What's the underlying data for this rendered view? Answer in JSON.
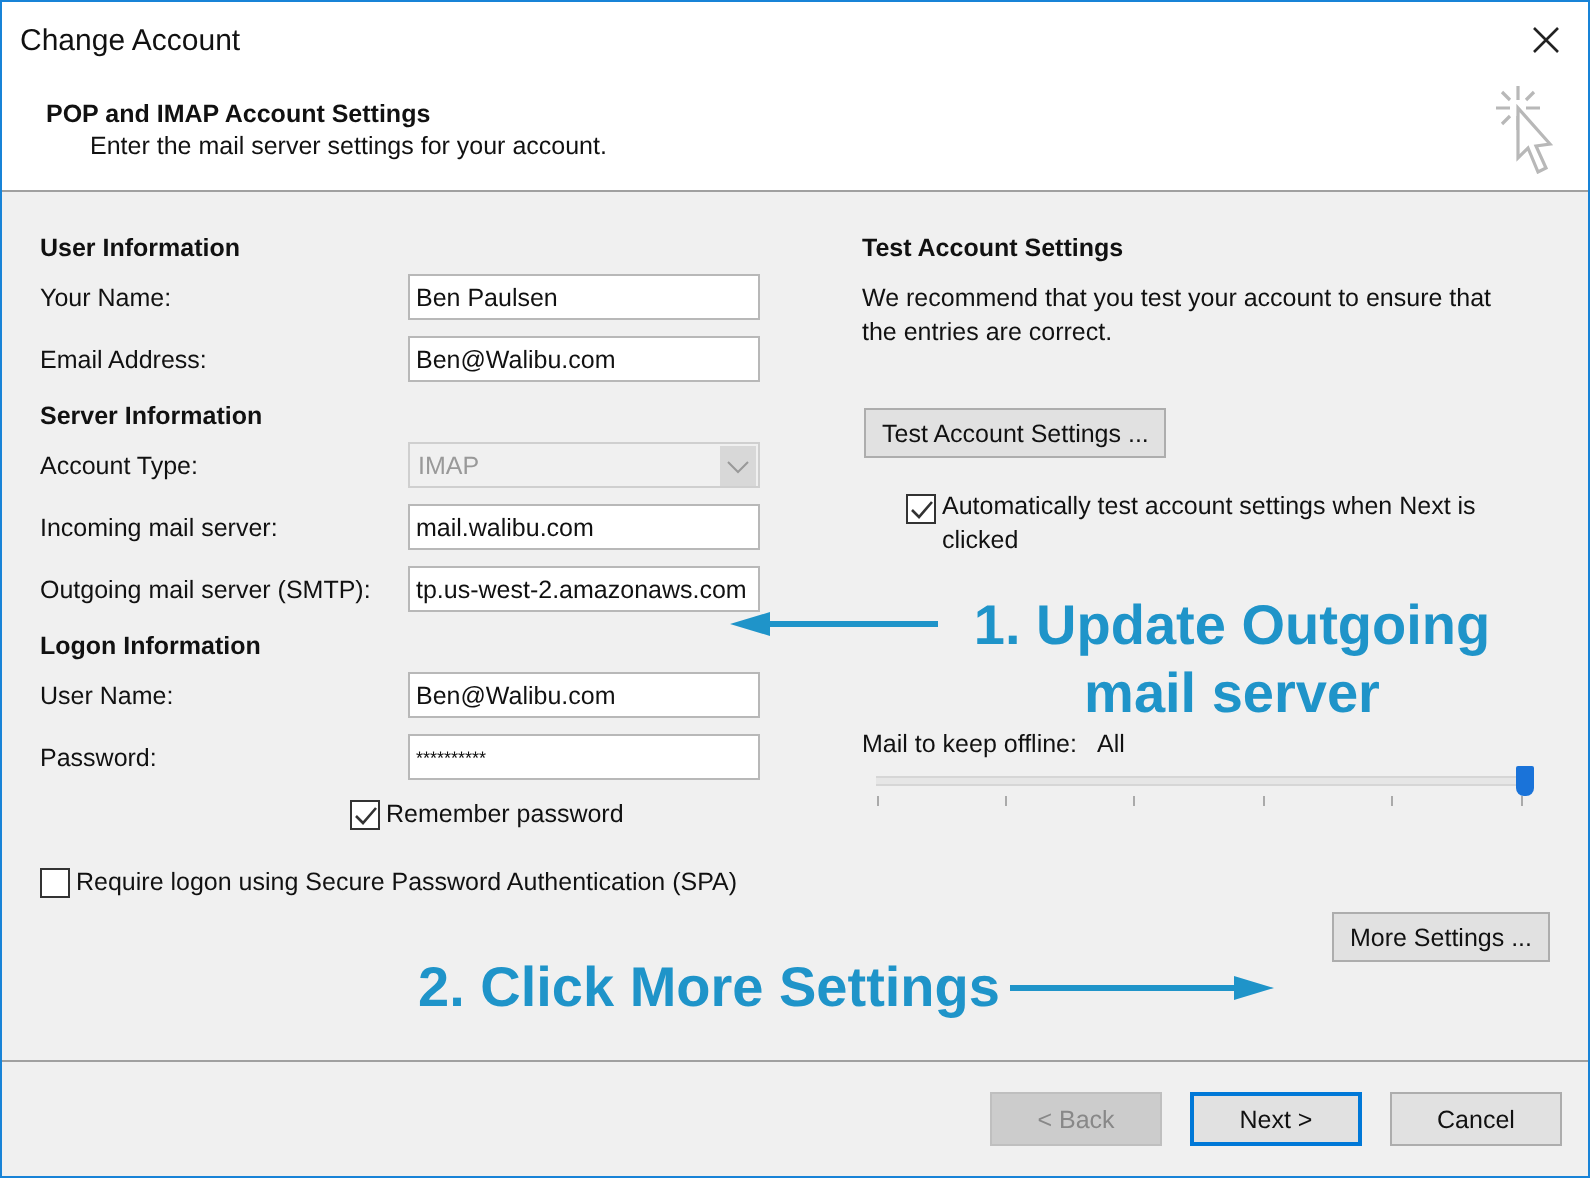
{
  "window": {
    "title": "Change Account"
  },
  "header": {
    "title": "POP and IMAP Account Settings",
    "subtitle": "Enter the mail server settings for your account."
  },
  "sections": [
    {
      "heading": "User Information",
      "fields": [
        {
          "kind": "text",
          "label": "Your Name:",
          "value": "Ben Paulsen"
        },
        {
          "kind": "text",
          "label": "Email Address:",
          "value": "Ben@Walibu.com"
        }
      ]
    },
    {
      "heading": "Server Information",
      "fields": [
        {
          "kind": "dropdown",
          "label": "Account Type:",
          "value": "IMAP",
          "disabled": true
        },
        {
          "kind": "text",
          "label": "Incoming mail server:",
          "value": "mail.walibu.com"
        },
        {
          "kind": "text",
          "label": "Outgoing mail server (SMTP):",
          "value": "tp.us-west-2.amazonaws.com"
        }
      ]
    },
    {
      "heading": "Logon Information",
      "fields": [
        {
          "kind": "text",
          "label": "User Name:",
          "value": "Ben@Walibu.com"
        },
        {
          "kind": "password",
          "label": "Password:",
          "value": "**********"
        }
      ]
    }
  ],
  "remember_password": {
    "label": "Remember password",
    "checked": true
  },
  "spa": {
    "label": "Require logon using Secure Password Authentication (SPA)",
    "checked": false
  },
  "test": {
    "heading": "Test Account Settings",
    "description": "We recommend that you test your account to ensure that the entries are correct.",
    "button": "Test Account Settings ...",
    "auto_test": {
      "label": "Automatically test account settings when Next is clicked",
      "checked": true
    }
  },
  "offline": {
    "label": "Mail to keep offline:",
    "value": "All",
    "level": 1
  },
  "more_settings": "More Settings ...",
  "annotations": [
    {
      "text": "1. Update Outgoing mail server",
      "kind": "left"
    },
    {
      "text": "2. Click More Settings",
      "kind": "right"
    }
  ],
  "buttons": [
    {
      "label": "< Back",
      "disabled": true,
      "default": false
    },
    {
      "label": "Next >",
      "disabled": false,
      "default": true
    },
    {
      "label": "Cancel",
      "disabled": false,
      "default": false
    }
  ]
}
